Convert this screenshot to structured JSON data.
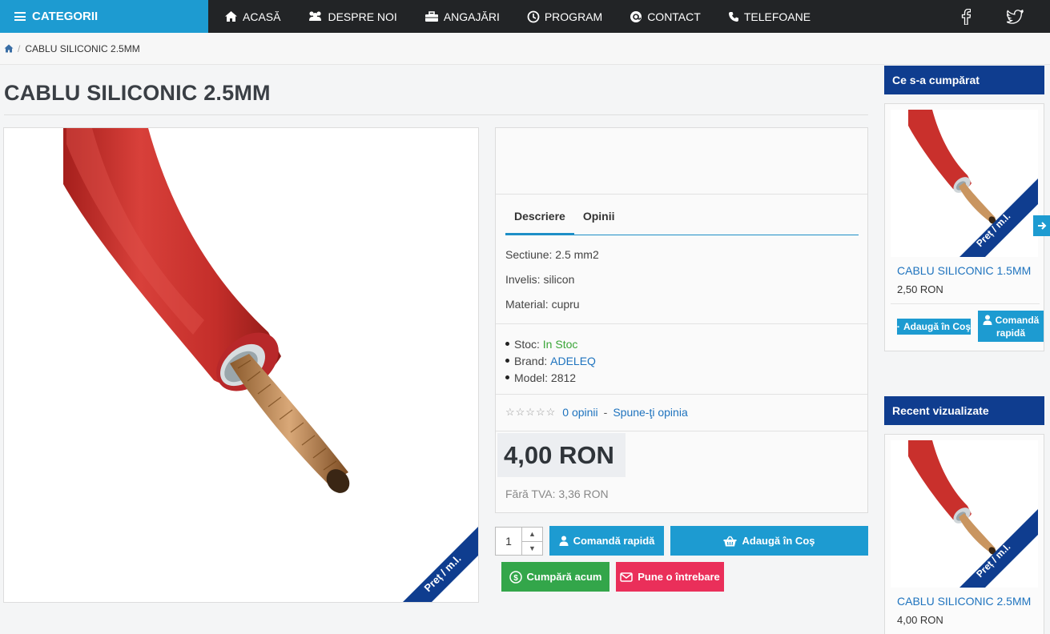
{
  "nav": {
    "categories_label": "CATEGORII",
    "items": [
      {
        "label": "ACASĂ",
        "icon": "home-icon"
      },
      {
        "label": "DESPRE NOI",
        "icon": "users-icon"
      },
      {
        "label": "ANGAJĂRI",
        "icon": "briefcase-icon"
      },
      {
        "label": "PROGRAM",
        "icon": "clock-icon"
      },
      {
        "label": "CONTACT",
        "icon": "mail-icon"
      },
      {
        "label": "TELEFOANE",
        "icon": "phone-icon"
      }
    ]
  },
  "breadcrumb": {
    "current": "CABLU SILICONIC 2.5MM"
  },
  "product": {
    "title": "CABLU SILICONIC 2.5MM",
    "badge": "Preț / m.l.",
    "tabs": [
      "Descriere",
      "Opinii"
    ],
    "description": [
      "Sectiune: 2.5 mm2",
      "Invelis: silicon",
      "Material: cupru"
    ],
    "stock_label": "Stoc:",
    "stock_value": "In Stoc",
    "brand_label": "Brand:",
    "brand_value": "ADELEQ",
    "model_label": "Model:",
    "model_value": "2812",
    "reviews_count": "0 opinii",
    "review_link": "Spune-ţi opinia",
    "rating": 0,
    "price": "4,00 RON",
    "price_no_vat": "Fără TVA: 3,36 RON",
    "quantity": "1"
  },
  "buttons": {
    "quick_order": "Comandă rapidă",
    "add_to_cart": "Adaugă în Coş",
    "buy_now": "Cumpără acum",
    "ask_question": "Pune o întrebare"
  },
  "sidebar": {
    "bought_title": "Ce s-a cumpărat",
    "bought": {
      "name": "CABLU SILICONIC 1.5MM",
      "price": "2,50 RON",
      "add_label": "Adaugă în Coş",
      "quick_label_1": "Comandă",
      "quick_label_2": "rapidă",
      "badge": "Preț / m.l."
    },
    "recent_title": "Recent vizualizate",
    "recent": {
      "name": "CABLU SILICONIC 2.5MM",
      "price": "4,00 RON",
      "badge": "Preț / m.l."
    }
  },
  "colors": {
    "topbar": "#222426",
    "accent_blue": "#1d9bd1",
    "sidebar_header": "#0f3d8f",
    "green": "#33a64a",
    "pink": "#ea2f5a",
    "cable_red": "#c9302c"
  }
}
